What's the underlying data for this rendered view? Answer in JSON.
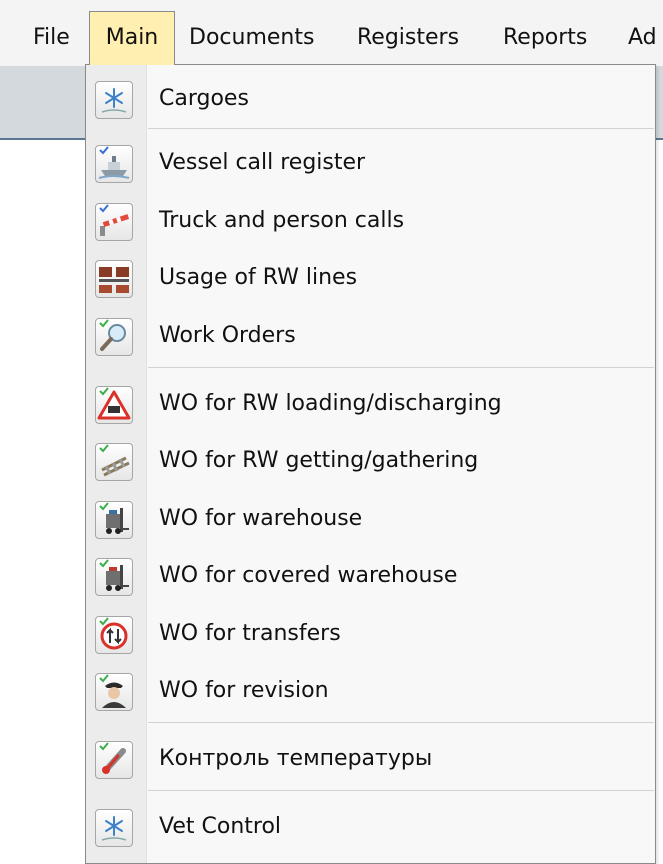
{
  "menubar": {
    "items": [
      "File",
      "Main",
      "Documents",
      "Registers",
      "Reports",
      "Ad"
    ]
  },
  "menu": {
    "items": [
      {
        "label": "Cargoes",
        "icon": "snowflake-icon"
      },
      {
        "label": "Vessel call register",
        "icon": "vessel-icon"
      },
      {
        "label": "Truck and person calls",
        "icon": "barrier-icon"
      },
      {
        "label": "Usage of RW lines",
        "icon": "rail-wagon-icon"
      },
      {
        "label": "Work Orders",
        "icon": "magnifier-icon"
      },
      {
        "label": "WO for RW loading/discharging",
        "icon": "warning-wagon-icon"
      },
      {
        "label": "WO for RW getting/gathering",
        "icon": "rail-track-icon"
      },
      {
        "label": "WO for warehouse",
        "icon": "forklift-icon"
      },
      {
        "label": "WO for covered warehouse",
        "icon": "forklift-covered-icon"
      },
      {
        "label": "WO for transfers",
        "icon": "transfer-sign-icon"
      },
      {
        "label": "WO for revision",
        "icon": "inspector-icon"
      },
      {
        "label": "Контроль температуры",
        "icon": "thermometer-icon"
      },
      {
        "label": "Vet Control",
        "icon": "snowflake-icon"
      }
    ]
  },
  "colors": {
    "active_menu_bg": "#ffefb0",
    "menu_bg": "#f8f8f8",
    "check_accent": "#3a6fd8"
  }
}
